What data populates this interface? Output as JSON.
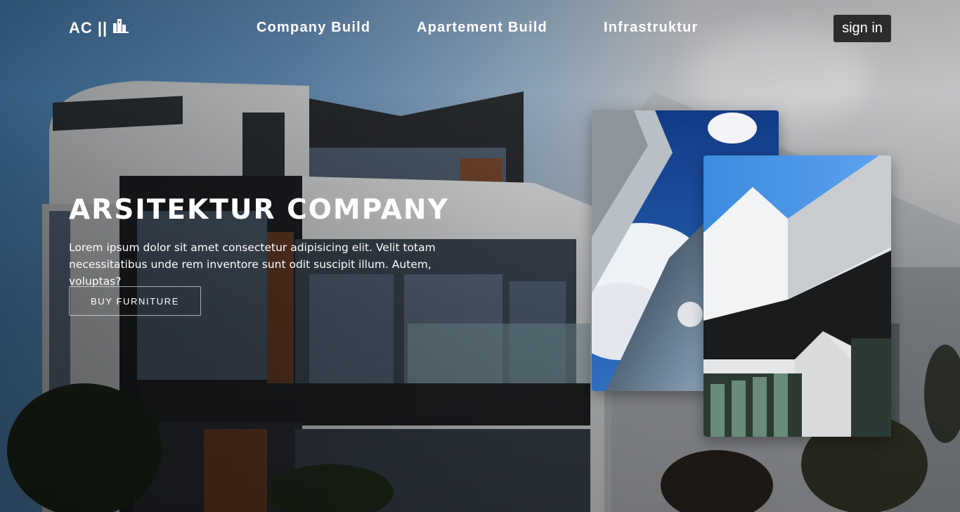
{
  "brand": {
    "text": "AC ||",
    "icon": "building-icon"
  },
  "nav": {
    "links": [
      {
        "label": "Company Build"
      },
      {
        "label": "Apartement Build"
      },
      {
        "label": "Infrastruktur"
      }
    ],
    "signin_label": "sign in"
  },
  "hero": {
    "title": "ARSITEKTUR COMPANY",
    "text": "Lorem ipsum dolor sit amet consectetur adipisicing elit. Velit totam necessitatibus unde rem inventore sunt odit suscipit illum. Autem, voluptas?",
    "cta_label": "BUY FURNITURE"
  },
  "colors": {
    "text": "#ffffff",
    "button_bg": "#2c2c2c",
    "sky": "#5b95cc"
  }
}
